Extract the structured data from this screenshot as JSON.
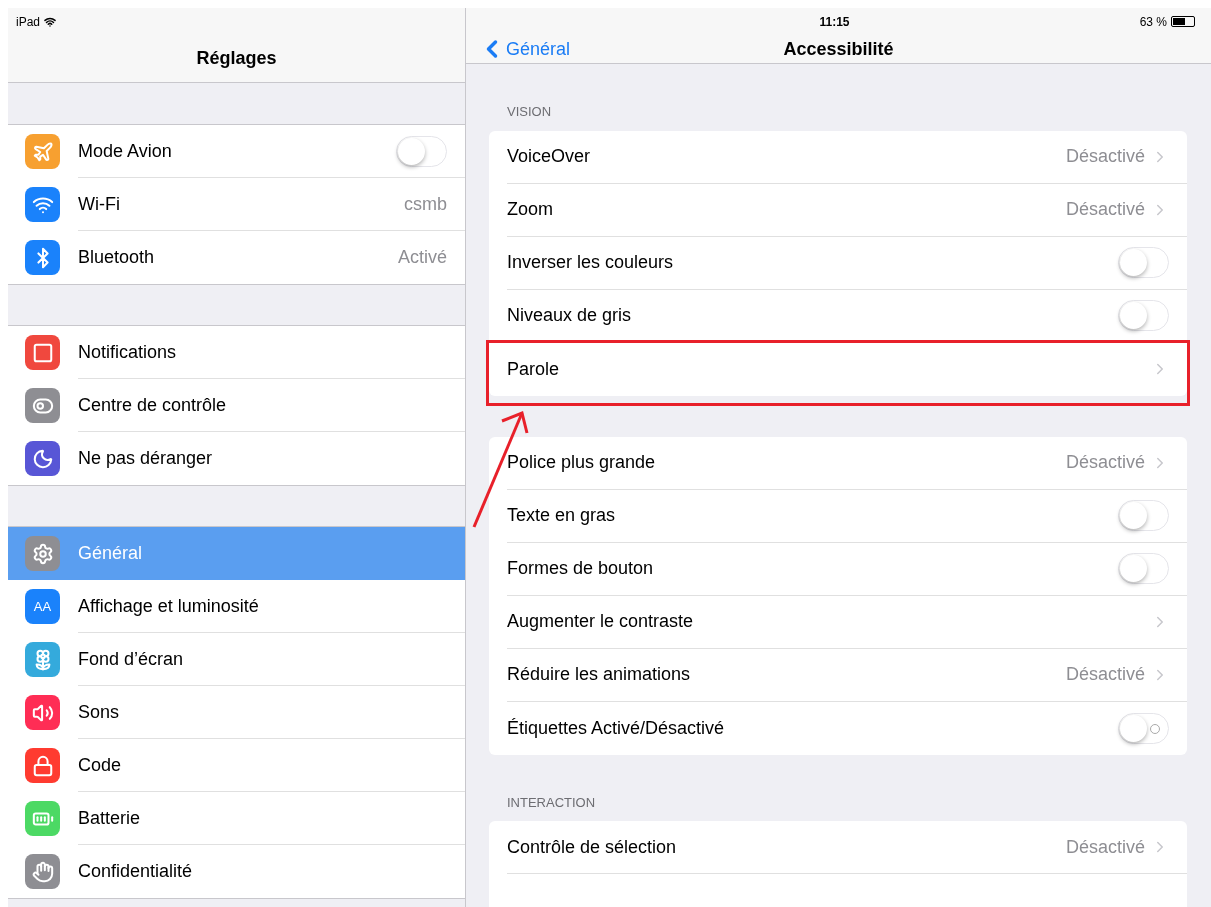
{
  "status_bar": {
    "device": "iPad",
    "time": "11:15",
    "battery": "63 %"
  },
  "sidebar": {
    "title": "Réglages",
    "groups": [
      {
        "items": [
          {
            "label": "Mode Avion",
            "color": "#f7a030",
            "kind": "switch",
            "on": false,
            "selected": false
          },
          {
            "label": "Wi-Fi",
            "color": "#1a82fb",
            "kind": "detail",
            "value": "csmb",
            "selected": false
          },
          {
            "label": "Bluetooth",
            "color": "#1a82fb",
            "kind": "detail",
            "value": "Activé",
            "selected": false
          }
        ]
      },
      {
        "items": [
          {
            "label": "Notifications",
            "color": "#f0483e",
            "kind": "plain",
            "selected": false
          },
          {
            "label": "Centre de contrôle",
            "color": "#8e8e93",
            "kind": "plain",
            "selected": false
          },
          {
            "label": "Ne pas déranger",
            "color": "#5856d6",
            "kind": "plain",
            "selected": false
          }
        ]
      },
      {
        "items": [
          {
            "label": "Général",
            "color": "#8e8e93",
            "kind": "plain",
            "selected": true
          },
          {
            "label": "Affichage et luminosité",
            "color": "#1a82fb",
            "kind": "plain",
            "icon_text": "AA",
            "selected": false
          },
          {
            "label": "Fond d’écran",
            "color": "#34aadc",
            "kind": "plain",
            "selected": false
          },
          {
            "label": "Sons",
            "color": "#ff2d55",
            "kind": "plain",
            "selected": false
          },
          {
            "label": "Code",
            "color": "#ff3b30",
            "kind": "plain",
            "selected": false
          },
          {
            "label": "Batterie",
            "color": "#4cd964",
            "kind": "plain",
            "selected": false
          },
          {
            "label": "Confidentialité",
            "color": "#8e8e93",
            "kind": "plain",
            "selected": false
          }
        ]
      }
    ]
  },
  "detail": {
    "back": "Général",
    "title": "Accessibilité",
    "sections": [
      {
        "header": "VISION",
        "rows": [
          {
            "label": "VoiceOver",
            "kind": "detail",
            "value": "Désactivé"
          },
          {
            "label": "Zoom",
            "kind": "detail",
            "value": "Désactivé"
          },
          {
            "label": "Inverser les couleurs",
            "kind": "switch",
            "on": false
          },
          {
            "label": "Niveaux de gris",
            "kind": "switch",
            "on": false
          },
          {
            "label": "Parole",
            "kind": "detail",
            "highlighted": true
          }
        ]
      },
      {
        "rows": [
          {
            "label": "Police plus grande",
            "kind": "detail",
            "value": "Désactivé"
          },
          {
            "label": "Texte en gras",
            "kind": "switch",
            "on": false
          },
          {
            "label": "Formes de bouton",
            "kind": "switch",
            "on": false
          },
          {
            "label": "Augmenter le contraste",
            "kind": "detail"
          },
          {
            "label": "Réduire les animations",
            "kind": "detail",
            "value": "Désactivé"
          },
          {
            "label": "Étiquettes Activé/Désactivé",
            "kind": "labeled_switch",
            "on": false
          }
        ]
      },
      {
        "header": "INTERACTION",
        "rows": [
          {
            "label": "Contrôle de sélection",
            "kind": "detail",
            "value": "Désactivé"
          },
          {
            "kind": "cut"
          }
        ]
      }
    ]
  }
}
